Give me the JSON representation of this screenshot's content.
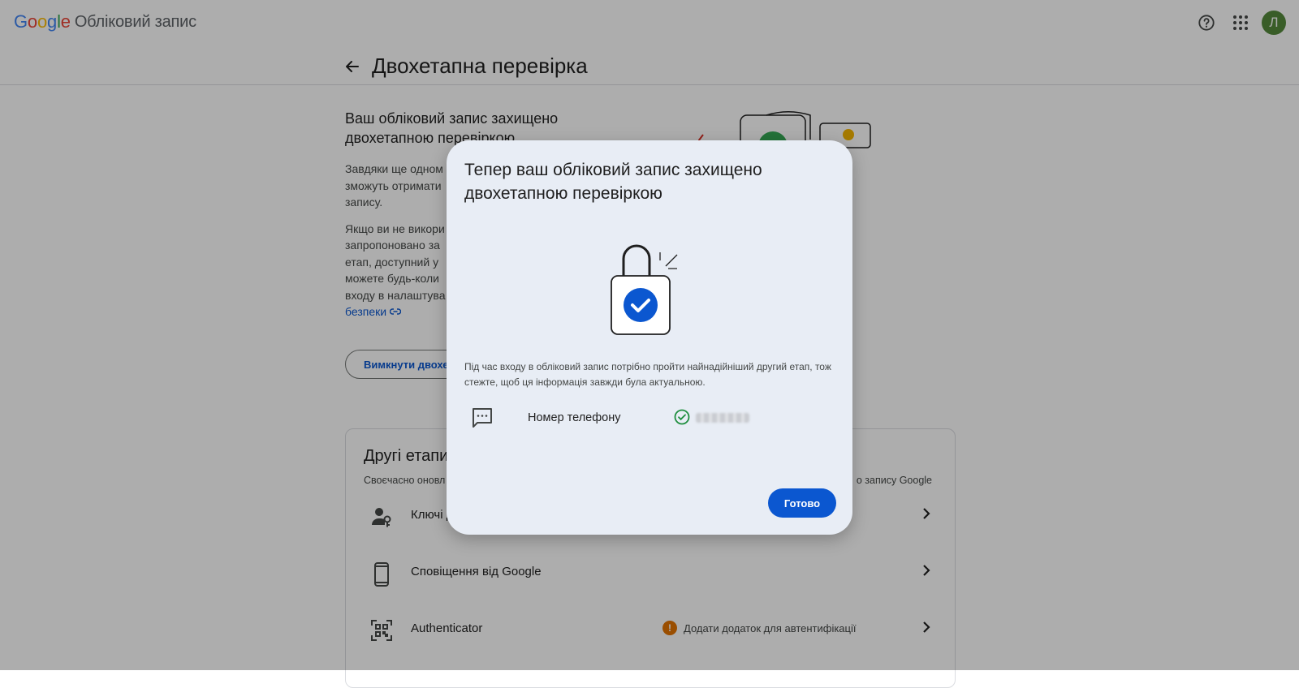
{
  "header": {
    "logo_letters": [
      "G",
      "o",
      "o",
      "g",
      "l",
      "e"
    ],
    "product": "Обліковий запис",
    "avatar_initial": "Л"
  },
  "page": {
    "title": "Двохетапна перевірка",
    "heading": "Ваш обліковий запис захищено двохетапною перевіркою",
    "para1": "Завдяки ще одному зможуть отримати записку.",
    "para1_visible": [
      "Завдяки ще одном",
      "зможуть отримати",
      "запису."
    ],
    "para2_visible": [
      "Якщо ви не викори",
      "запропоновано за",
      "етап, доступний у",
      "можете будь-коли",
      "входу в налаштува"
    ],
    "security_link": "безпеки",
    "turn_off_button": "Вимкнути двохет"
  },
  "card": {
    "title": "Другі етапи",
    "subtitle_left": "Своєчасно оновл",
    "subtitle_right": "о запису Google",
    "rows": [
      {
        "label": "Ключі д",
        "icon": "passkey-icon"
      },
      {
        "label": "Сповіщення від Google",
        "icon": "phone-icon"
      },
      {
        "label": "Authenticator",
        "icon": "qr-icon",
        "warning": "Додати додаток для автентифікації"
      }
    ]
  },
  "dialog": {
    "title": "Тепер ваш обліковий запис захищено двохетапною перевіркою",
    "body": "Під час входу в обліковий запис потрібно пройти найнадійніший другий етап, тож стежте, щоб ця інформація завжди була актуальною.",
    "method_label": "Номер телефону",
    "done_button": "Готово"
  },
  "colors": {
    "primary": "#0b57d0",
    "dialog_bg": "#e8edf5",
    "success": "#1e8e3e",
    "warning": "#e37400",
    "avatar": "#54893b"
  }
}
